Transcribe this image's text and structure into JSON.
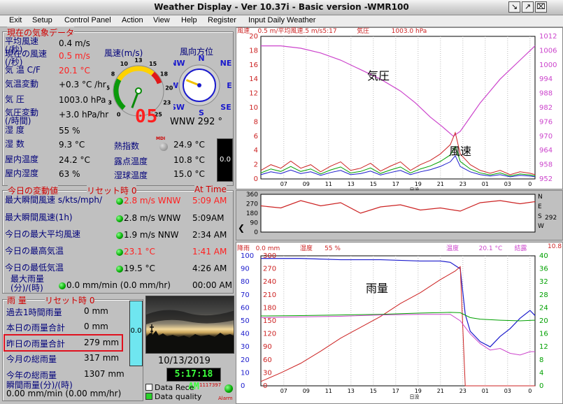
{
  "window": {
    "title": "Weather Display - Ver 10.37i - Basic version  -WMR100",
    "controls": [
      "↘",
      "↗",
      "⌧"
    ]
  },
  "menu": [
    "Exit",
    "Setup",
    "Control Panel",
    "Action",
    "View",
    "Help",
    "Register",
    "Input Daily Weather"
  ],
  "current": {
    "section_title": "現在の気象データ",
    "rows": [
      {
        "label": "平均風速\n(/秒)",
        "value": "0.4 m/s",
        "alert": false
      },
      {
        "label": "現在の風速\n(/秒)",
        "value": "0.5 m/s",
        "alert": true
      },
      {
        "label": "気 温 C/F",
        "value": "20.1 °C",
        "alert": true
      },
      {
        "label": "気温変動",
        "value": "+0.3 °C /hr",
        "alert": false
      },
      {
        "label": "気 圧",
        "value": "1003.0 hPa",
        "alert": false
      },
      {
        "label": "気圧変動\n(/時間)",
        "value": "+3.0 hPa/hr",
        "alert": false
      },
      {
        "label": "湿 度",
        "value": "55 %",
        "alert": false
      },
      {
        "label": "湿 数",
        "value": "9.3 °C",
        "alert": false
      },
      {
        "label": "屋内温度",
        "value": "24.2 °C",
        "alert": false
      },
      {
        "label": "屋内湿度",
        "value": "63 %",
        "alert": false
      }
    ],
    "extra": [
      {
        "label": "熱指数",
        "value": "24.9 °C"
      },
      {
        "label": "露点温度",
        "value": "10.8 °C"
      },
      {
        "label": "湿球温度",
        "value": "15.0 °C"
      }
    ],
    "mdi": "MDI",
    "wind_gauge": {
      "title": "風速(m/s)",
      "ticks": [
        "0",
        "3",
        "5",
        "8",
        "10",
        "13",
        "15",
        "18",
        "20",
        "23",
        "25"
      ],
      "digital": "05",
      "speed": 0.5
    },
    "compass": {
      "title": "風向方位",
      "dirs": [
        "N",
        "NE",
        "E",
        "SE",
        "S",
        "SW",
        "W",
        "NW"
      ],
      "reading": "WNW 292 °",
      "degrees": 292
    },
    "side_meter": "0.0"
  },
  "daily": {
    "section_title": "今日の変動値",
    "reset_label": "リセット時 0",
    "at_time": "At Time",
    "rows": [
      {
        "label": "最大瞬間風速 s/kts/mph/",
        "value": "2.8 m/s WNW",
        "time": "5:09 AM",
        "alert": true
      },
      {
        "label": "最大瞬間風速(1h)",
        "value": "2.8 m/s WNW",
        "time": "5:09AM",
        "alert": false
      },
      {
        "label": "今日の最大平均風速",
        "value": "1.9 m/s NNW",
        "time": "2:34 AM",
        "alert": false
      },
      {
        "label": "今日の最高気温",
        "value": "23.1 °C",
        "time": "1:41 AM",
        "alert": true
      },
      {
        "label": "今日の最低気温",
        "value": "19.5 °C",
        "time": "4:26 AM",
        "alert": false
      },
      {
        "label": "最大雨量\n(分)/(時)",
        "value": "0.0 mm/min (0.0 mm/hr)",
        "time": "00:00 AM",
        "alert": false
      }
    ]
  },
  "rain": {
    "section_title": "雨 量",
    "reset_label": "リセット時 0",
    "rows": [
      {
        "label": "過去1時間雨量",
        "value": "0 mm"
      },
      {
        "label": "本日の雨量合計",
        "value": "0 mm"
      },
      {
        "label": "昨日の雨量合計",
        "value": "279 mm"
      },
      {
        "label": "今月の総雨量",
        "value": "317 mm"
      },
      {
        "label": "今年の総雨量",
        "value": "1307 mm"
      },
      {
        "label": "瞬間雨量(分)/(時)",
        "value": "0.00 mm/min (0.00 mm/hr)"
      }
    ],
    "meter": "0.0"
  },
  "webcam": {
    "date": "10/13/2019",
    "time": "5:17:18 AM"
  },
  "status": {
    "data_rece": "Data Rece",
    "counter": "1117397",
    "data_quality": "Data quality",
    "alarm": "Alarm"
  },
  "colors": {
    "bg": "#c0c0c0",
    "label": "#00007a",
    "alert": "#ff2020",
    "title_red": "#d00000",
    "pressure": "#cc44cc",
    "wind": "#00a000",
    "rain": "#cc2222",
    "humidity": "#1a1acc"
  },
  "chart_data": [
    {
      "type": "line",
      "header": "風速    0.5 m/平均風速.5 m/s5:17          気圧           1003.0 hPa",
      "annotations": [
        "気圧",
        "風速"
      ],
      "x_ticks": [
        "07",
        "09",
        "11",
        "13",
        "15",
        "17",
        "19",
        "21",
        "23",
        "01",
        "03",
        "0"
      ],
      "x_label": "日没",
      "y_left": [
        "0",
        "2",
        "4",
        "6",
        "8",
        "10",
        "12",
        "14",
        "16",
        "18",
        "20"
      ],
      "y_right": [
        "952",
        "958",
        "964",
        "970",
        "976",
        "982",
        "988",
        "994",
        "1000",
        "1006",
        "1012"
      ],
      "series": [
        {
          "name": "気圧",
          "points": [
            [
              0,
              1008
            ],
            [
              2,
              1008
            ],
            [
              4,
              1007
            ],
            [
              6,
              1005
            ],
            [
              8,
              1002
            ],
            [
              10,
              998
            ],
            [
              12,
              994
            ],
            [
              14,
              989
            ],
            [
              15.5,
              984
            ],
            [
              17,
              978
            ],
            [
              18.2,
              974
            ],
            [
              19.3,
              970
            ],
            [
              20,
              972
            ],
            [
              21,
              978
            ],
            [
              22,
              984
            ],
            [
              23,
              989
            ],
            [
              24,
              994
            ],
            [
              25,
              998
            ],
            [
              26,
              1002
            ],
            [
              27,
              1006
            ],
            [
              27.5,
              1008
            ]
          ]
        },
        {
          "name": "風速",
          "points": [
            [
              0,
              1.2
            ],
            [
              1,
              2
            ],
            [
              2,
              1.5
            ],
            [
              3,
              2.5
            ],
            [
              4,
              1.5
            ],
            [
              5,
              2
            ],
            [
              6,
              1
            ],
            [
              7,
              1.8
            ],
            [
              8,
              2.4
            ],
            [
              9,
              1.2
            ],
            [
              10,
              1.5
            ],
            [
              11,
              2.2
            ],
            [
              12,
              1.1
            ],
            [
              13,
              1.8
            ],
            [
              14,
              2.4
            ],
            [
              15,
              1.2
            ],
            [
              16,
              2
            ],
            [
              17,
              2.6
            ],
            [
              18,
              3.5
            ],
            [
              19,
              4.8
            ],
            [
              19.5,
              6.5
            ],
            [
              20,
              3.5
            ],
            [
              21,
              2
            ],
            [
              22,
              1.2
            ],
            [
              23,
              0.8
            ],
            [
              24,
              1.2
            ],
            [
              25,
              0.6
            ],
            [
              26,
              1
            ],
            [
              27,
              0.8
            ],
            [
              27.5,
              0.6
            ]
          ]
        }
      ]
    },
    {
      "type": "scatter",
      "header": "",
      "x_ticks": [
        "07",
        "09",
        "11",
        "13",
        "15",
        "17",
        "19",
        "21",
        "23",
        "01",
        "03",
        "0"
      ],
      "y_left": [
        "0",
        "90",
        "180",
        "270",
        "360"
      ],
      "y_right": [
        "N",
        "E",
        "S",
        "W"
      ],
      "current": "292",
      "series": [
        {
          "name": "風向",
          "points": [
            [
              0,
              250
            ],
            [
              2,
              230
            ],
            [
              4,
              300
            ],
            [
              6,
              250
            ],
            [
              8,
              280
            ],
            [
              10,
              180
            ],
            [
              12,
              240
            ],
            [
              14,
              260
            ],
            [
              16,
              210
            ],
            [
              18,
              230
            ],
            [
              20,
              200
            ],
            [
              22,
              280
            ],
            [
              24,
              300
            ],
            [
              26,
              270
            ],
            [
              27.5,
              290
            ]
          ]
        }
      ]
    },
    {
      "type": "line",
      "header_left": "降雨   0.0 mm          湿度      55 %",
      "header_right": "温度          20.1 °C      結露",
      "header_value": "10.8",
      "annotations": [
        "雨量"
      ],
      "x_ticks": [
        "07",
        "09",
        "11",
        "13",
        "15",
        "17",
        "19",
        "21",
        "23",
        "01",
        "03",
        "0"
      ],
      "x_label": "日没",
      "y_left": [
        "0",
        "10",
        "20",
        "30",
        "40",
        "50",
        "60",
        "70",
        "80",
        "90",
        "100"
      ],
      "y_mid": [
        "0",
        "30",
        "60",
        "90",
        "120",
        "150",
        "180",
        "210",
        "240",
        "270",
        "300"
      ],
      "y_right": [
        "0",
        "4",
        "8",
        "12",
        "16",
        "20",
        "24",
        "28",
        "32",
        "36",
        "40"
      ],
      "series": [
        {
          "name": "湿度",
          "points": [
            [
              0,
              98
            ],
            [
              4,
              98
            ],
            [
              8,
              97
            ],
            [
              12,
              97
            ],
            [
              16,
              96
            ],
            [
              18,
              96
            ],
            [
              19,
              95
            ],
            [
              20,
              90
            ],
            [
              20.5,
              55
            ],
            [
              21,
              42
            ],
            [
              22,
              34
            ],
            [
              23,
              30
            ],
            [
              24,
              38
            ],
            [
              25,
              44
            ],
            [
              26,
              52
            ],
            [
              27,
              58
            ],
            [
              27.5,
              54
            ]
          ]
        },
        {
          "name": "雨量",
          "points": [
            [
              0,
              10
            ],
            [
              2,
              30
            ],
            [
              4,
              52
            ],
            [
              6,
              80
            ],
            [
              8,
              110
            ],
            [
              10,
              135
            ],
            [
              12,
              160
            ],
            [
              14,
              190
            ],
            [
              16,
              215
            ],
            [
              18,
              245
            ],
            [
              19.5,
              265
            ],
            [
              20,
              275
            ],
            [
              20.5,
              0
            ],
            [
              27.5,
              0
            ]
          ]
        },
        {
          "name": "温度",
          "points": [
            [
              0,
              21.5
            ],
            [
              4,
              21.6
            ],
            [
              8,
              21.8
            ],
            [
              12,
              22
            ],
            [
              16,
              22.4
            ],
            [
              19,
              22.6
            ],
            [
              20,
              22.5
            ],
            [
              21,
              21
            ],
            [
              22,
              20.5
            ],
            [
              24,
              20.2
            ],
            [
              26,
              20
            ],
            [
              27.5,
              20.2
            ]
          ]
        },
        {
          "name": "結露",
          "points": [
            [
              0,
              21
            ],
            [
              4,
              21.2
            ],
            [
              8,
              21.4
            ],
            [
              12,
              21.8
            ],
            [
              16,
              22
            ],
            [
              19,
              22
            ],
            [
              20,
              20
            ],
            [
              21,
              16
            ],
            [
              22,
              13
            ],
            [
              23,
              11
            ],
            [
              24,
              11.5
            ],
            [
              25,
              10
            ],
            [
              26,
              9.5
            ],
            [
              27,
              10.5
            ],
            [
              27.5,
              10.5
            ]
          ]
        }
      ]
    }
  ]
}
